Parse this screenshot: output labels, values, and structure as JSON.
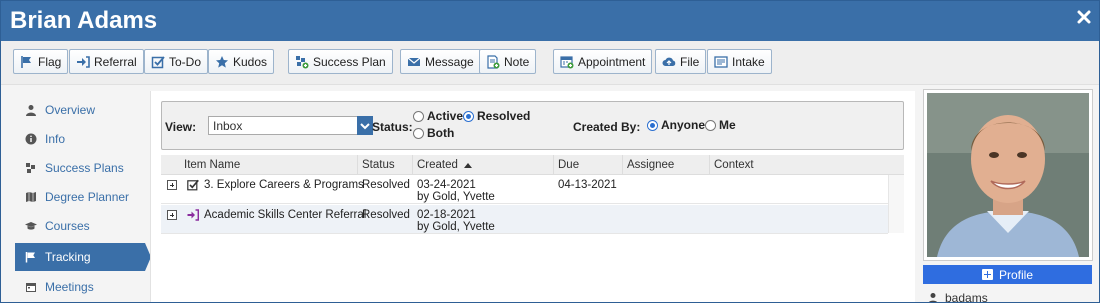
{
  "window": {
    "title": "Brian Adams",
    "close_icon": "close-icon"
  },
  "toolbar": [
    {
      "label": "Flag",
      "icon": "flag-icon"
    },
    {
      "label": "Referral",
      "icon": "referral-icon"
    },
    {
      "label": "To-Do",
      "icon": "checkbox-icon"
    },
    {
      "label": "Kudos",
      "icon": "star-icon"
    },
    {
      "label": "Success Plan",
      "icon": "success-plan-icon"
    },
    {
      "label": "Message",
      "icon": "envelope-icon"
    },
    {
      "label": "Note",
      "icon": "note-icon"
    },
    {
      "label": "Appointment",
      "icon": "calendar-icon"
    },
    {
      "label": "File",
      "icon": "cloud-upload-icon"
    },
    {
      "label": "Intake",
      "icon": "intake-form-icon"
    }
  ],
  "sidebar": {
    "items": [
      {
        "label": "Overview",
        "icon": "person-icon",
        "active": false
      },
      {
        "label": "Info",
        "icon": "info-icon",
        "active": false
      },
      {
        "label": "Success Plans",
        "icon": "puzzle-icon",
        "active": false
      },
      {
        "label": "Degree Planner",
        "icon": "map-icon",
        "active": false
      },
      {
        "label": "Courses",
        "icon": "graduation-cap-icon",
        "active": false
      },
      {
        "label": "Tracking",
        "icon": "flag-icon",
        "active": true
      },
      {
        "label": "Meetings",
        "icon": "calendar-icon",
        "active": false
      }
    ]
  },
  "filters": {
    "view_label": "View:",
    "view_value": "Inbox",
    "status_label": "Status:",
    "status_options": [
      {
        "label": "Active",
        "selected": false
      },
      {
        "label": "Resolved",
        "selected": true
      },
      {
        "label": "Both",
        "selected": false
      }
    ],
    "created_by_label": "Created By:",
    "created_by_options": [
      {
        "label": "Anyone",
        "selected": true
      },
      {
        "label": "Me",
        "selected": false
      }
    ]
  },
  "grid": {
    "columns": [
      "Item Name",
      "Status",
      "Created",
      "Due",
      "Assignee",
      "Context"
    ],
    "sort_column": "Created",
    "sort_icon": "sort-up-icon",
    "rows": [
      {
        "icon": "checkbox-icon",
        "item_name": "3. Explore Careers & Programs",
        "status": "Resolved",
        "created_date": "03-24-2021",
        "created_by": "by Gold, Yvette",
        "due": "04-13-2021",
        "assignee": "",
        "context": ""
      },
      {
        "icon": "referral-icon",
        "item_name": "Academic Skills Center Referral",
        "status": "Resolved",
        "created_date": "02-18-2021",
        "created_by": "by Gold, Yvette",
        "due": "",
        "assignee": "",
        "context": ""
      }
    ]
  },
  "profile": {
    "button_label": "Profile",
    "username": "badams",
    "photo": "student-photo"
  },
  "colors": {
    "brand_blue": "#3a6fa8",
    "profile_button": "#2f6de0",
    "referral_purple": "#8a2c9e"
  }
}
